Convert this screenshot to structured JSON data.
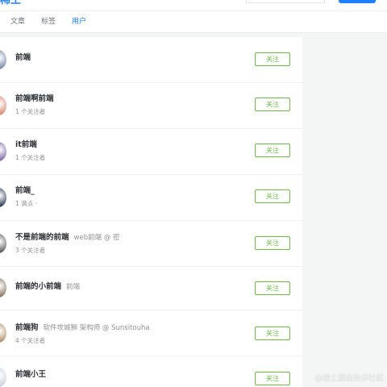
{
  "header": {
    "logo_fragment": "稀土",
    "colors": {
      "brand": "#1e80ff",
      "follow": "#6cbd45",
      "meta": "#909090"
    }
  },
  "tabs": [
    {
      "label": "文章",
      "active": false
    },
    {
      "label": "标签",
      "active": false
    },
    {
      "label": "用户",
      "active": true
    }
  ],
  "users": [
    {
      "name": "前端",
      "title": "",
      "meta": "",
      "follow_label": "关注",
      "avatar_color": "#7a86a8"
    },
    {
      "name": "前端啊前端",
      "title": "",
      "meta": "1 个关注者",
      "follow_label": "关注",
      "avatar_color": "#d98870"
    },
    {
      "name": "it前端",
      "title": "",
      "meta": "1 个关注者",
      "follow_label": "关注",
      "avatar_color": "#7f6aa8"
    },
    {
      "name": "前端_",
      "title": "",
      "meta": "1 滴点 ·",
      "follow_label": "关注",
      "avatar_color": "#2c3a56"
    },
    {
      "name": "不是前端的前端",
      "title": "web前端 @ 密",
      "meta": "3 个关注者",
      "follow_label": "关注",
      "avatar_color": "#5a5a5a"
    },
    {
      "name": "前端的小前端",
      "title": "前端",
      "meta": "",
      "follow_label": "关注",
      "avatar_color": "#8a7360"
    },
    {
      "name": "前端狗",
      "title": "软件攻城狮 架构师 @ Sunsitouha",
      "meta": "4 个关注者",
      "follow_label": "关注",
      "avatar_color": "#b49068"
    },
    {
      "name": "前端小王",
      "title": "",
      "meta": "",
      "follow_label": "关注",
      "avatar_color": "#c9d1dc"
    }
  ],
  "watermark": "@稀土掘金技术社区"
}
